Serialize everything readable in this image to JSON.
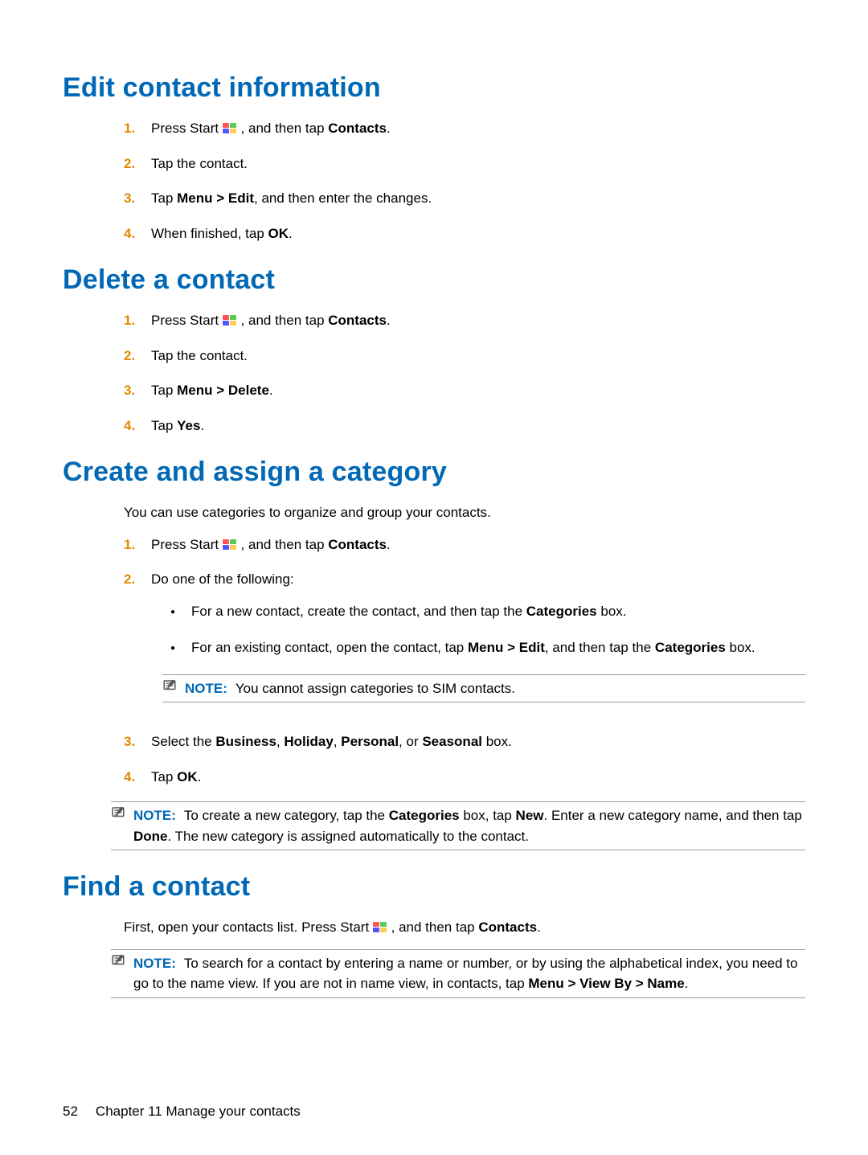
{
  "sections": {
    "edit": {
      "title": "Edit contact information",
      "steps": {
        "s1a": "Press Start ",
        "s1b": ", and then tap ",
        "s1c": "Contacts",
        "s1d": ".",
        "s2": "Tap the contact.",
        "s3a": "Tap ",
        "s3b": "Menu > Edit",
        "s3c": ", and then enter the changes.",
        "s4a": "When finished, tap ",
        "s4b": "OK",
        "s4c": "."
      }
    },
    "delete": {
      "title": "Delete a contact",
      "steps": {
        "s1a": "Press Start ",
        "s1b": ", and then tap ",
        "s1c": "Contacts",
        "s1d": ".",
        "s2": "Tap the contact.",
        "s3a": "Tap ",
        "s3b": "Menu > Delete",
        "s3c": ".",
        "s4a": "Tap ",
        "s4b": "Yes",
        "s4c": "."
      }
    },
    "category": {
      "title": "Create and assign a category",
      "lead": "You can use categories to organize and group your contacts.",
      "steps": {
        "s1a": "Press Start ",
        "s1b": ", and then tap ",
        "s1c": "Contacts",
        "s1d": ".",
        "s2": "Do one of the following:",
        "s2_b1a": "For a new contact, create the contact, and then tap the ",
        "s2_b1b": "Categories",
        "s2_b1c": " box.",
        "s2_b2a": "For an existing contact, open the contact, tap ",
        "s2_b2b": "Menu > Edit",
        "s2_b2c": ", and then tap the ",
        "s2_b2d": "Categories",
        "s2_b2e": " box.",
        "note_inner_label": "NOTE:",
        "note_inner_text": "You cannot assign categories to SIM contacts.",
        "s3a": "Select the ",
        "s3b": "Business",
        "s3c": ", ",
        "s3d": "Holiday",
        "s3e": ", ",
        "s3f": "Personal",
        "s3g": ", or ",
        "s3h": "Seasonal",
        "s3i": " box.",
        "s4a": "Tap ",
        "s4b": "OK",
        "s4c": "."
      },
      "note_outer": {
        "label": "NOTE:",
        "a": "To create a new category, tap the ",
        "b": "Categories",
        "c": " box, tap ",
        "d": "New",
        "e": ". Enter a new category name, and then tap ",
        "f": "Done",
        "g": ". The new category is assigned automatically to the contact."
      }
    },
    "find": {
      "title": "Find a contact",
      "lead_a": "First, open your contacts list. Press Start ",
      "lead_b": ", and then tap ",
      "lead_c": "Contacts",
      "lead_d": ".",
      "note": {
        "label": "NOTE:",
        "a": "To search for a contact by entering a name or number, or by using the alphabetical index, you need to go to the name view. If you are not in name view, in contacts, tap ",
        "b": "Menu > View By > Name",
        "c": "."
      }
    }
  },
  "markers": {
    "n1": "1.",
    "n2": "2.",
    "n3": "3.",
    "n4": "4."
  },
  "footer": {
    "page": "52",
    "chapter": "Chapter 11   Manage your contacts"
  }
}
